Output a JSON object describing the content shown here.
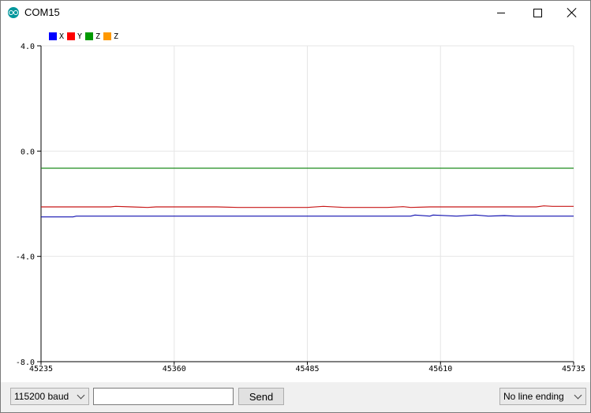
{
  "window": {
    "title": "COM15",
    "app_icon": "arduino-logo-icon",
    "controls": {
      "minimize": "minimize-icon",
      "maximize": "maximize-icon",
      "close": "close-icon"
    }
  },
  "chart_data": {
    "type": "line",
    "x_ticks": [
      "45235",
      "45360",
      "45485",
      "45610",
      "45735"
    ],
    "y_ticks": [
      "4.0",
      "0.0",
      "-4.0",
      "-8.0"
    ],
    "xlim": [
      45235,
      45735
    ],
    "ylim": [
      -8.0,
      4.0
    ],
    "grid": true,
    "legend_placement": "top-left",
    "legend": [
      {
        "name": "X",
        "color": "#0000ff"
      },
      {
        "name": "Y",
        "color": "#ff0000"
      },
      {
        "name": "Z",
        "color": "#009900"
      },
      {
        "name": "Z",
        "color": "#ff9900"
      }
    ],
    "series": [
      {
        "name": "X",
        "color": "#1010b0",
        "x": [
          45235,
          45265,
          45268,
          45325,
          45385,
          45435,
          45485,
          45535,
          45582,
          45586,
          45600,
          45603,
          45625,
          45643,
          45655,
          45670,
          45680,
          45700,
          45735
        ],
        "y": [
          -2.5,
          -2.5,
          -2.47,
          -2.47,
          -2.47,
          -2.47,
          -2.47,
          -2.47,
          -2.47,
          -2.43,
          -2.47,
          -2.43,
          -2.47,
          -2.43,
          -2.47,
          -2.45,
          -2.47,
          -2.47,
          -2.47
        ]
      },
      {
        "name": "Y",
        "color": "#c81818",
        "x": [
          45235,
          45300,
          45305,
          45320,
          45335,
          45343,
          45360,
          45400,
          45420,
          45485,
          45500,
          45520,
          45560,
          45575,
          45582,
          45600,
          45700,
          45707,
          45715,
          45735
        ],
        "y": [
          -2.12,
          -2.12,
          -2.1,
          -2.12,
          -2.14,
          -2.12,
          -2.12,
          -2.12,
          -2.14,
          -2.14,
          -2.1,
          -2.14,
          -2.14,
          -2.11,
          -2.14,
          -2.12,
          -2.12,
          -2.08,
          -2.1,
          -2.1
        ]
      },
      {
        "name": "Z",
        "color": "#1e8c1e",
        "x": [
          45235,
          45735
        ],
        "y": [
          -0.65,
          -0.65
        ]
      },
      {
        "name": "Z",
        "color": "#ff9900",
        "x": [],
        "y": []
      }
    ]
  },
  "footer": {
    "baud": "115200 baud",
    "send_value": "",
    "send_label": "Send",
    "line_ending": "No line ending"
  }
}
